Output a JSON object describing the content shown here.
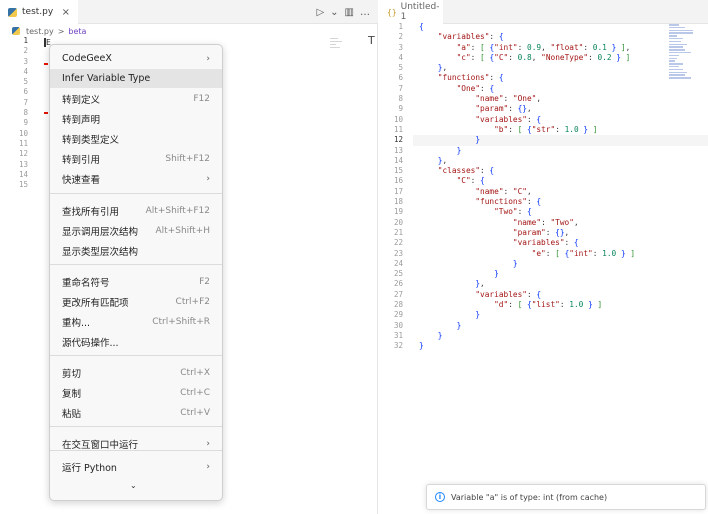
{
  "left_editor": {
    "tab_label": "test.py",
    "tab_close": "×",
    "breadcrumb": {
      "file": "test.py",
      "separator": ">",
      "symbol": "beta"
    },
    "line_numbers": [
      "1",
      "2",
      "3",
      "4",
      "5",
      "6",
      "7",
      "8",
      "9",
      "10",
      "11",
      "12",
      "13",
      "14",
      "15"
    ],
    "glyph": "E",
    "actions": {
      "run": "▷",
      "run_menu": "⌄",
      "split": "▥",
      "more": "…"
    },
    "text_cursor_glyph": "T"
  },
  "context_menu": {
    "items": [
      {
        "label": "CodeGeeX",
        "shortcut": "",
        "submenu": true
      },
      {
        "label": "Infer Variable Type",
        "shortcut": "",
        "submenu": false,
        "highlighted": true
      },
      {
        "label": "转到定义",
        "shortcut": "F12",
        "submenu": false
      },
      {
        "label": "转到声明",
        "shortcut": "",
        "submenu": false
      },
      {
        "label": "转到类型定义",
        "shortcut": "",
        "submenu": false
      },
      {
        "label": "转到引用",
        "shortcut": "Shift+F12",
        "submenu": false
      },
      {
        "label": "快速查看",
        "shortcut": "",
        "submenu": true
      },
      {
        "label": "查找所有引用",
        "shortcut": "Alt+Shift+F12",
        "submenu": false
      },
      {
        "label": "显示调用层次结构",
        "shortcut": "Alt+Shift+H",
        "submenu": false
      },
      {
        "label": "显示类型层次结构",
        "shortcut": "",
        "submenu": false
      },
      {
        "label": "重命名符号",
        "shortcut": "F2",
        "submenu": false
      },
      {
        "label": "更改所有匹配项",
        "shortcut": "Ctrl+F2",
        "submenu": false
      },
      {
        "label": "重构...",
        "shortcut": "Ctrl+Shift+R",
        "submenu": false
      },
      {
        "label": "源代码操作...",
        "shortcut": "",
        "submenu": false
      },
      {
        "label": "剪切",
        "shortcut": "Ctrl+X",
        "submenu": false
      },
      {
        "label": "复制",
        "shortcut": "Ctrl+C",
        "submenu": false
      },
      {
        "label": "粘贴",
        "shortcut": "Ctrl+V",
        "submenu": false
      },
      {
        "label": "在交互窗口中运行",
        "shortcut": "",
        "submenu": true
      },
      {
        "label": "运行 Python",
        "shortcut": "",
        "submenu": true
      }
    ],
    "arrow_glyph": "›",
    "scroll_glyph": "⌄"
  },
  "right_editor": {
    "tab_label": "Untitled-1",
    "tab_icon": "{}",
    "tab_close": "×",
    "line_numbers": [
      "1",
      "2",
      "3",
      "4",
      "5",
      "6",
      "7",
      "8",
      "9",
      "10",
      "11",
      "12",
      "13",
      "14",
      "15",
      "16",
      "17",
      "18",
      "19",
      "20",
      "21",
      "22",
      "23",
      "24",
      "25",
      "26",
      "27",
      "28",
      "29",
      "30",
      "31",
      "32"
    ],
    "active_line": "12",
    "code_lines": [
      "{",
      "    \"variables\": {",
      "        \"a\": [ {\"int\": 0.9, \"float\": 0.1 } ],",
      "        \"c\": [ {\"C\": 0.8, \"NoneType\": 0.2 } ]",
      "    },",
      "    \"functions\": {",
      "        \"One\": {",
      "            \"name\": \"One\",",
      "            \"param\": {},",
      "            \"variables\": {",
      "                \"b\": [ {\"str\": 1.0 } ]",
      "            }",
      "        }",
      "    },",
      "    \"classes\": {",
      "        \"C\": {",
      "            \"name\": \"C\",",
      "            \"functions\": {",
      "                \"Two\": {",
      "                    \"name\": \"Two\",",
      "                    \"param\": {},",
      "                    \"variables\": {",
      "                        \"e\": [ {\"int\": 1.0 } ]",
      "                    }",
      "                }",
      "            },",
      "            \"variables\": {",
      "                \"d\": [ {\"list\": 1.0 } ]",
      "            }",
      "        }",
      "    }",
      "}"
    ]
  },
  "notification": {
    "icon": "i",
    "message": "Variable \"a\" is of type: int (from cache)"
  }
}
